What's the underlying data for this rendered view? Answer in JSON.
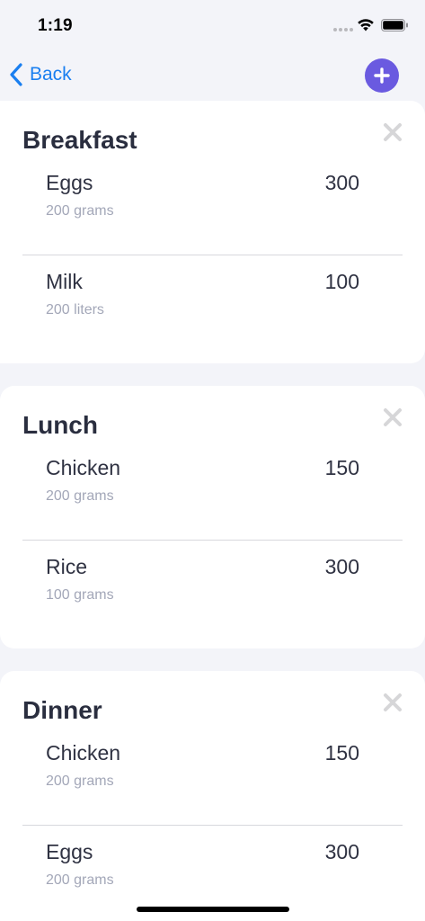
{
  "status_bar": {
    "time": "1:19"
  },
  "nav": {
    "back_label": "Back",
    "add_icon": "plus-icon"
  },
  "colors": {
    "accent": "#1a7ff0",
    "add_button": "#6a5ae0",
    "background": "#f3f4f9"
  },
  "meals": [
    {
      "title": "Breakfast",
      "items": [
        {
          "name": "Eggs",
          "quantity": "200 grams",
          "calories": "300"
        },
        {
          "name": "Milk",
          "quantity": "200 liters",
          "calories": "100"
        }
      ]
    },
    {
      "title": "Lunch",
      "items": [
        {
          "name": "Chicken",
          "quantity": "200 grams",
          "calories": "150"
        },
        {
          "name": "Rice",
          "quantity": "100 grams",
          "calories": "300"
        }
      ]
    },
    {
      "title": "Dinner",
      "items": [
        {
          "name": "Chicken",
          "quantity": "200 grams",
          "calories": "150"
        },
        {
          "name": "Eggs",
          "quantity": "200 grams",
          "calories": "300"
        }
      ]
    }
  ]
}
